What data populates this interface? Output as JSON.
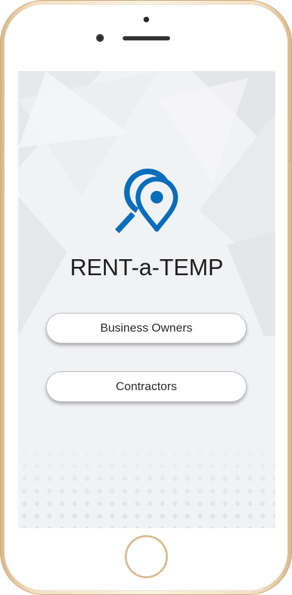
{
  "app": {
    "title": "RENT-a-TEMP"
  },
  "buttons": {
    "business_owners": "Business Owners",
    "contractors": "Contractors"
  },
  "icons": {
    "logo": "location-search-logo-icon"
  },
  "colors": {
    "brand_blue": "#0a6dbb",
    "frame_gold": "#e8cda6",
    "screen_bg": "#f1f2f4",
    "button_text": "#2a2a2a"
  }
}
